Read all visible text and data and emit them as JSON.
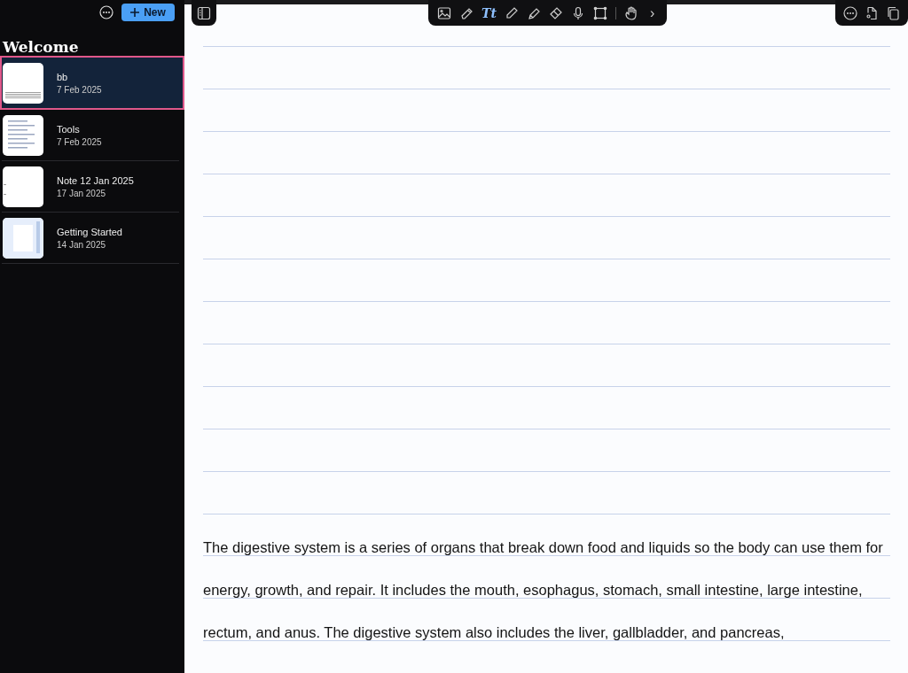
{
  "sidebar": {
    "new_button": {
      "label": "New"
    },
    "heading": "Welcome",
    "notes": [
      {
        "title": "bb",
        "date": "7 Feb 2025",
        "selected": true
      },
      {
        "title": "Tools",
        "date": "7 Feb 2025",
        "selected": false
      },
      {
        "title": "Note 12 Jan 2025",
        "date": "17 Jan 2025",
        "selected": false
      },
      {
        "title": "Getting Started",
        "date": "14 Jan 2025",
        "selected": false
      }
    ]
  },
  "toolbar": {
    "tools": [
      {
        "kind": "image",
        "selected": false
      },
      {
        "kind": "pen",
        "selected": false
      },
      {
        "kind": "text",
        "label": "Tt",
        "selected": true
      },
      {
        "kind": "pencil",
        "selected": false
      },
      {
        "kind": "highlighter",
        "selected": false
      },
      {
        "kind": "eraser",
        "selected": false
      },
      {
        "kind": "mic",
        "selected": false
      },
      {
        "kind": "select",
        "selected": false
      },
      {
        "kind": "divider"
      },
      {
        "kind": "hand",
        "selected": false
      },
      {
        "kind": "chevron",
        "label": "›"
      }
    ]
  },
  "note": {
    "text": "The digestive system is a series of organs that break down food and liquids so the body can use them for energy, growth, and repair. It includes the mouth, esophagus, stomach, small intestine, large intestine, rectum, and anus. The digestive system also includes the liver, gallbladder, and pancreas,"
  }
}
